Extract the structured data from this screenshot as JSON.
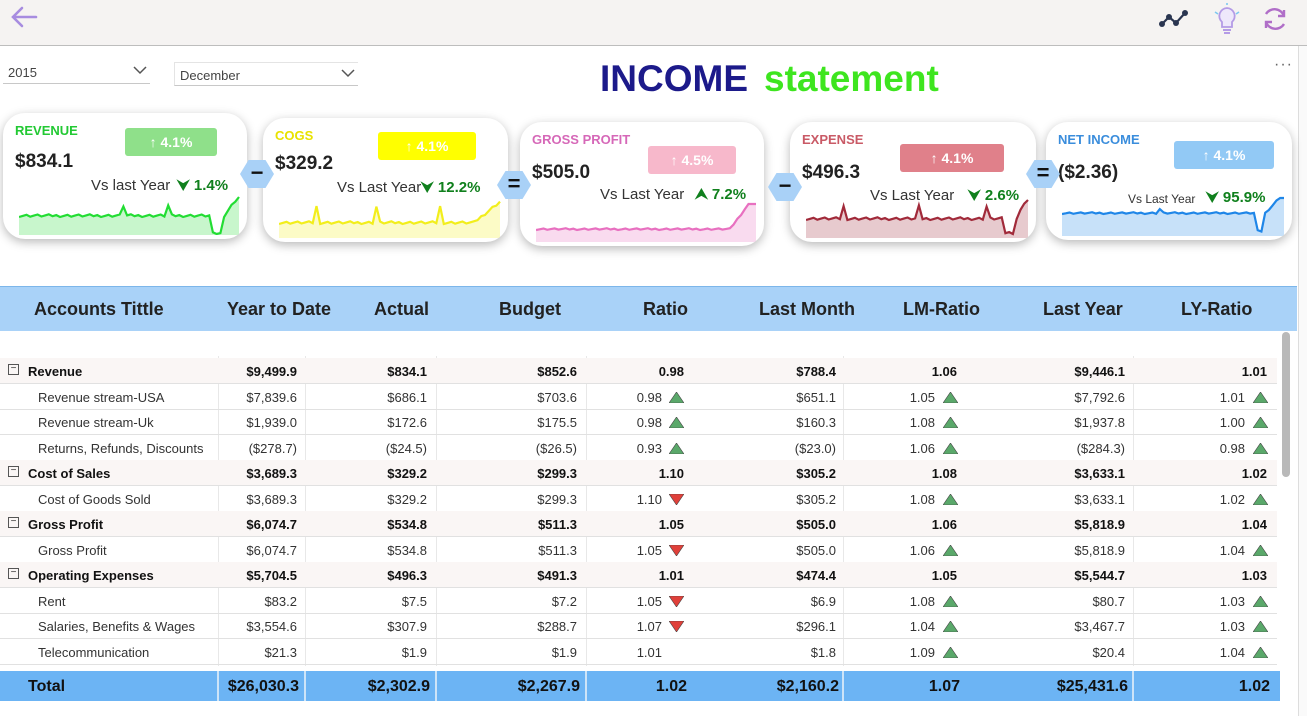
{
  "toolbar": {
    "back_icon": "back-arrow-icon",
    "icons": [
      "trend-icon",
      "lightbulb-icon",
      "refresh-icon"
    ]
  },
  "filters": {
    "year": "2015",
    "month": "December"
  },
  "title": {
    "word1": "INCOME",
    "word2": "statement"
  },
  "more_icon": "···",
  "cards": [
    {
      "label": "REVENUE",
      "badge": "↑ 4.1%",
      "amount": "$834.1",
      "vs": "Vs last Year",
      "pct": "1.4%",
      "arrow": "down",
      "color": "#22dd33",
      "badge_color": "#8fe08a",
      "label_color": "#22c933"
    },
    {
      "label": "COGS",
      "badge": "↑ 4.1%",
      "amount": "$329.2",
      "vs": "Vs Last Year",
      "pct": "12.2%",
      "arrow": "down",
      "color": "#f2ee1c",
      "badge_color": "#ffff00",
      "label_color": "#e8e200"
    },
    {
      "label": "GROSS PROFIT",
      "badge": "↑ 4.5%",
      "amount": "$505.0",
      "vs": "Vs Last Year",
      "pct": "7.2%",
      "arrow": "up",
      "color": "#e870c0",
      "badge_color": "#f7b8cb",
      "label_color": "#d668b8"
    },
    {
      "label": "EXPENSE",
      "badge": "↑ 4.1%",
      "amount": "$496.3",
      "vs": "Vs Last Year",
      "pct": "2.6%",
      "arrow": "down",
      "color": "#a12a3a",
      "badge_color": "#e0808a",
      "label_color": "#c95a66"
    },
    {
      "label": "NET INCOME",
      "badge": "↑ 4.1%",
      "amount": "($2.36)",
      "vs": "Vs Last Year",
      "pct": "95.9%",
      "arrow": "down",
      "color": "#1f86e8",
      "badge_color": "#92c9f5",
      "label_color": "#3a8ddc"
    }
  ],
  "operators": [
    "−",
    "=",
    "−",
    "="
  ],
  "table": {
    "headers": [
      "Accounts Tittle",
      "Year to Date",
      "Actual",
      "Budget",
      "Ratio",
      "Last Month",
      "LM-Ratio",
      "Last Year",
      "LY-Ratio"
    ],
    "rows": [
      {
        "group": true,
        "name": "Revenue",
        "ytd": "$9,499.9",
        "actual": "$834.1",
        "budget": "$852.6",
        "ratio": "0.98",
        "lm": "$788.4",
        "lmr": "1.06",
        "ly": "$9,446.1",
        "lyr": "1.01",
        "r_icon": "",
        "lm_icon": "",
        "ly_icon": ""
      },
      {
        "group": false,
        "name": "Revenue stream-USA",
        "ytd": "$7,839.6",
        "actual": "$686.1",
        "budget": "$703.6",
        "ratio": "0.98",
        "lm": "$651.1",
        "lmr": "1.05",
        "ly": "$7,792.6",
        "lyr": "1.01",
        "r_icon": "up",
        "lm_icon": "up",
        "ly_icon": "up"
      },
      {
        "group": false,
        "name": "Revenue stream-Uk",
        "ytd": "$1,939.0",
        "actual": "$172.6",
        "budget": "$175.5",
        "ratio": "0.98",
        "lm": "$160.3",
        "lmr": "1.08",
        "ly": "$1,937.8",
        "lyr": "1.00",
        "r_icon": "up",
        "lm_icon": "up",
        "ly_icon": "up"
      },
      {
        "group": false,
        "name": "Returns, Refunds, Discounts",
        "ytd": "($278.7)",
        "actual": "($24.5)",
        "budget": "($26.5)",
        "ratio": "0.93",
        "lm": "($23.0)",
        "lmr": "1.06",
        "ly": "($284.3)",
        "lyr": "0.98",
        "r_icon": "up",
        "lm_icon": "up",
        "ly_icon": "up"
      },
      {
        "group": true,
        "name": "Cost of Sales",
        "ytd": "$3,689.3",
        "actual": "$329.2",
        "budget": "$299.3",
        "ratio": "1.10",
        "lm": "$305.2",
        "lmr": "1.08",
        "ly": "$3,633.1",
        "lyr": "1.02",
        "r_icon": "",
        "lm_icon": "",
        "ly_icon": ""
      },
      {
        "group": false,
        "name": "Cost of Goods Sold",
        "ytd": "$3,689.3",
        "actual": "$329.2",
        "budget": "$299.3",
        "ratio": "1.10",
        "lm": "$305.2",
        "lmr": "1.08",
        "ly": "$3,633.1",
        "lyr": "1.02",
        "r_icon": "down",
        "lm_icon": "up",
        "ly_icon": "up"
      },
      {
        "group": true,
        "name": "Gross Profit",
        "ytd": "$6,074.7",
        "actual": "$534.8",
        "budget": "$511.3",
        "ratio": "1.05",
        "lm": "$505.0",
        "lmr": "1.06",
        "ly": "$5,818.9",
        "lyr": "1.04",
        "r_icon": "",
        "lm_icon": "",
        "ly_icon": ""
      },
      {
        "group": false,
        "name": "Gross Profit",
        "ytd": "$6,074.7",
        "actual": "$534.8",
        "budget": "$511.3",
        "ratio": "1.05",
        "lm": "$505.0",
        "lmr": "1.06",
        "ly": "$5,818.9",
        "lyr": "1.04",
        "r_icon": "down",
        "lm_icon": "up",
        "ly_icon": "up"
      },
      {
        "group": true,
        "name": "Operating Expenses",
        "ytd": "$5,704.5",
        "actual": "$496.3",
        "budget": "$491.3",
        "ratio": "1.01",
        "lm": "$474.4",
        "lmr": "1.05",
        "ly": "$5,544.7",
        "lyr": "1.03",
        "r_icon": "",
        "lm_icon": "",
        "ly_icon": ""
      },
      {
        "group": false,
        "name": "Rent",
        "ytd": "$83.2",
        "actual": "$7.5",
        "budget": "$7.2",
        "ratio": "1.05",
        "lm": "$6.9",
        "lmr": "1.08",
        "ly": "$80.7",
        "lyr": "1.03",
        "r_icon": "down",
        "lm_icon": "up",
        "ly_icon": "up"
      },
      {
        "group": false,
        "name": "Salaries, Benefits & Wages",
        "ytd": "$3,554.6",
        "actual": "$307.9",
        "budget": "$288.7",
        "ratio": "1.07",
        "lm": "$296.1",
        "lmr": "1.04",
        "ly": "$3,467.7",
        "lyr": "1.03",
        "r_icon": "down",
        "lm_icon": "up",
        "ly_icon": "up"
      },
      {
        "group": false,
        "name": "Telecommunication",
        "ytd": "$21.3",
        "actual": "$1.9",
        "budget": "$1.9",
        "ratio": "1.01",
        "lm": "$1.8",
        "lmr": "1.09",
        "ly": "$20.4",
        "lyr": "1.04",
        "r_icon": "",
        "lm_icon": "up",
        "ly_icon": "up"
      }
    ],
    "total": {
      "name": "Total",
      "ytd": "$26,030.3",
      "actual": "$2,302.9",
      "budget": "$2,267.9",
      "ratio": "1.02",
      "lm": "$2,160.2",
      "lmr": "1.07",
      "ly": "$25,431.6",
      "lyr": "1.02"
    }
  },
  "colors": {
    "accent_up": "#5aa86a",
    "accent_down": "#e0403a",
    "header_bg": "#a9d2f8",
    "total_bg": "#6cb4f4"
  }
}
